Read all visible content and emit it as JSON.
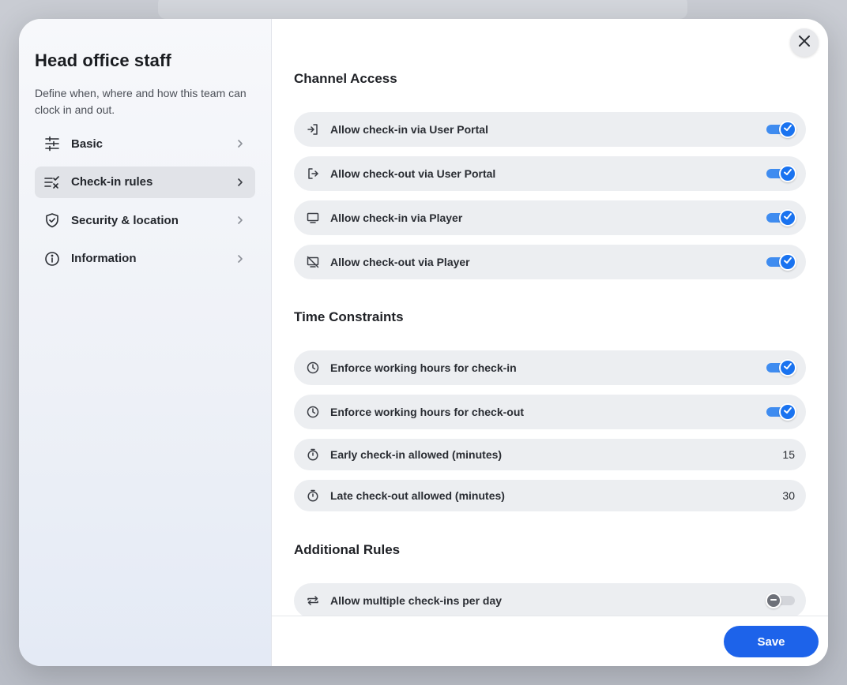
{
  "sidebar": {
    "title": "Head office staff",
    "description": "Define when, where and how this team can clock in and out.",
    "items": [
      {
        "label": "Basic",
        "icon": "sliders-icon",
        "active": false
      },
      {
        "label": "Check-in rules",
        "icon": "checklist-icon",
        "active": true
      },
      {
        "label": "Security & location",
        "icon": "shield-check-icon",
        "active": false
      },
      {
        "label": "Information",
        "icon": "info-icon",
        "active": false
      }
    ]
  },
  "sections": {
    "channel_access": {
      "title": "Channel Access",
      "rows": [
        {
          "label": "Allow check-in via User Portal",
          "icon": "login-icon",
          "toggle": true
        },
        {
          "label": "Allow check-out via User Portal",
          "icon": "logout-icon",
          "toggle": true
        },
        {
          "label": "Allow check-in via Player",
          "icon": "monitor-icon",
          "toggle": true
        },
        {
          "label": "Allow check-out via Player",
          "icon": "monitor-off-icon",
          "toggle": true
        }
      ]
    },
    "time_constraints": {
      "title": "Time Constraints",
      "rows": [
        {
          "label": "Enforce working hours for check-in",
          "icon": "clock-icon",
          "toggle": true
        },
        {
          "label": "Enforce working hours for check-out",
          "icon": "clock-icon",
          "toggle": true
        },
        {
          "label": "Early check-in allowed (minutes)",
          "icon": "stopwatch-icon",
          "value": "15"
        },
        {
          "label": "Late check-out allowed (minutes)",
          "icon": "stopwatch-icon",
          "value": "30"
        }
      ]
    },
    "additional_rules": {
      "title": "Additional Rules",
      "rows": [
        {
          "label": "Allow multiple check-ins per day",
          "icon": "repeat-icon",
          "toggle": false
        }
      ]
    }
  },
  "footer": {
    "save_label": "Save"
  },
  "colors": {
    "accent": "#1d63ea",
    "toggle_on": "#1a73f0",
    "row_bg": "#eceef1"
  }
}
